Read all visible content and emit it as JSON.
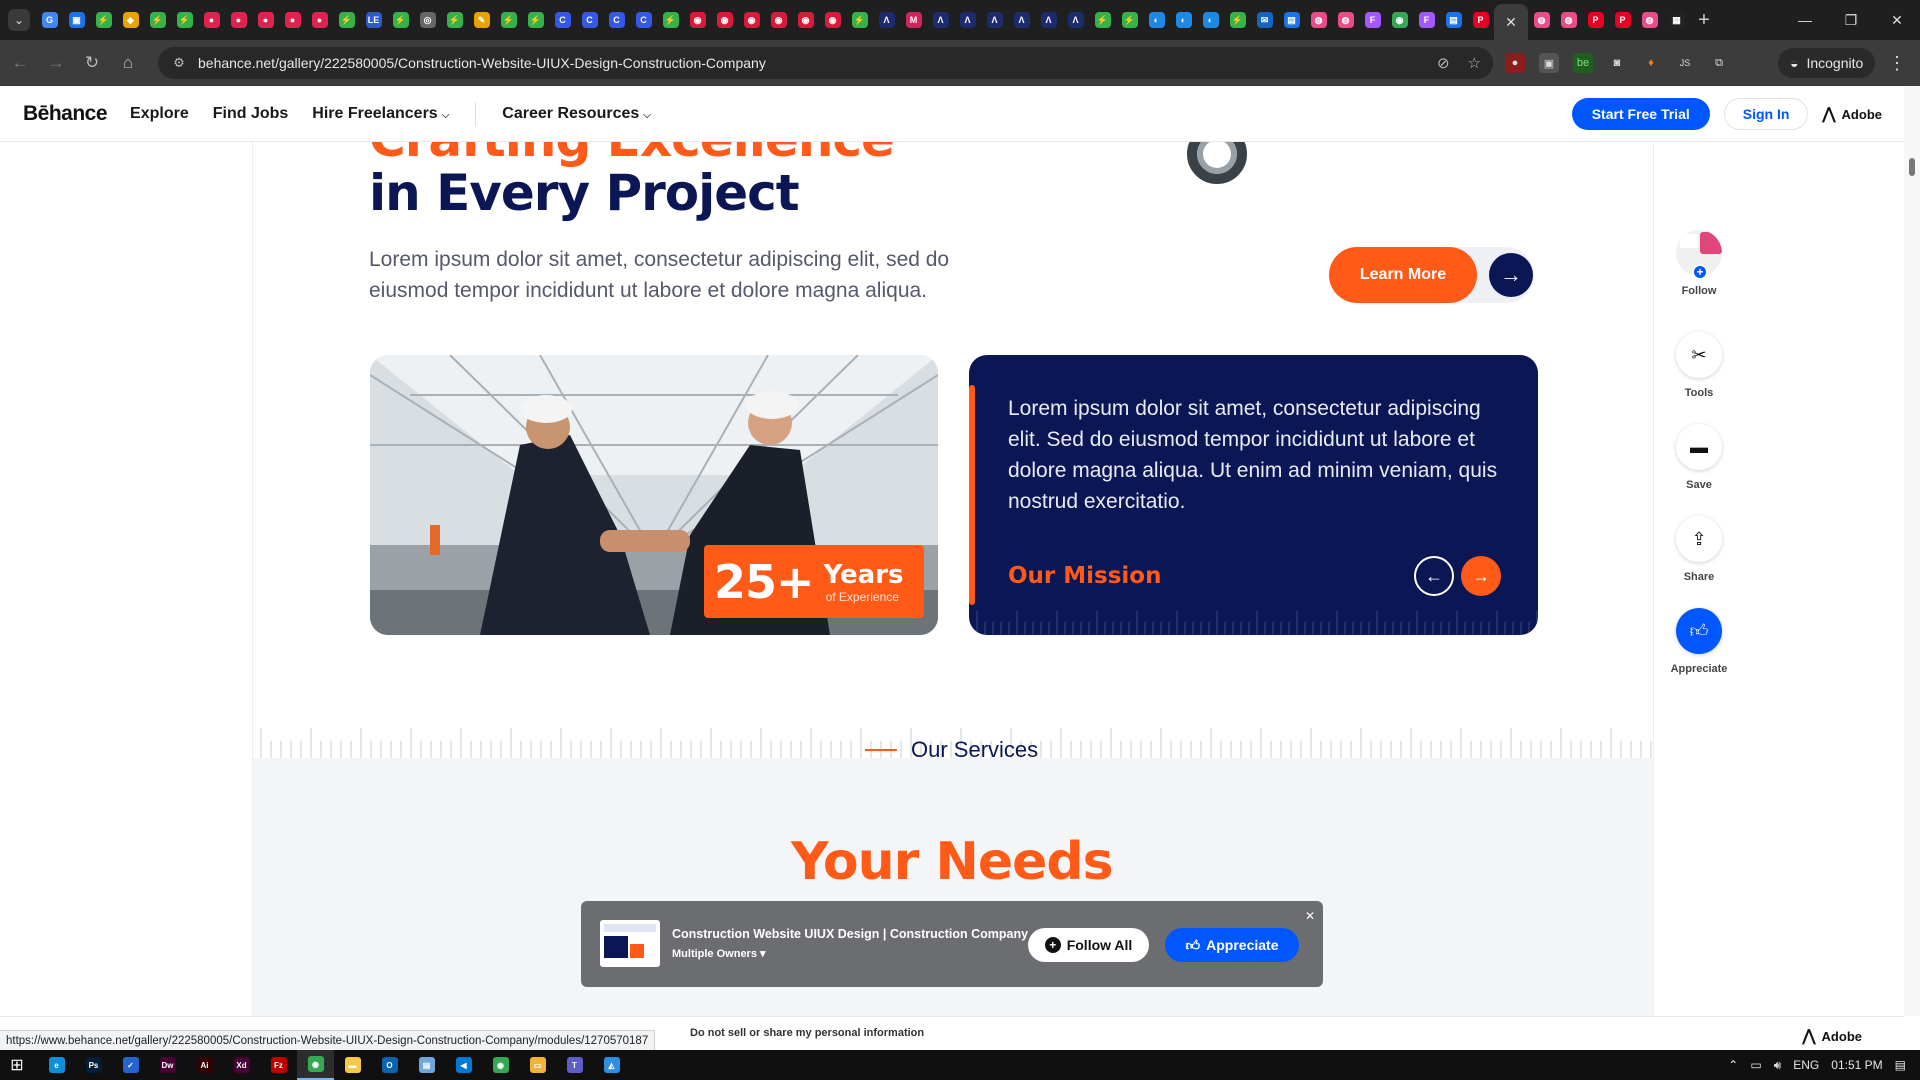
{
  "browser": {
    "tab_favicons": [
      {
        "name": "google-favicon",
        "color": "#4285f4",
        "glyph": "G"
      },
      {
        "name": "app-favicon",
        "color": "#1a73e8",
        "glyph": "▣"
      },
      {
        "name": "green-favicon",
        "color": "#36b24a",
        "glyph": "⚡"
      },
      {
        "name": "box-favicon",
        "color": "#e8a300",
        "glyph": "◆"
      },
      {
        "name": "green-favicon",
        "color": "#36b24a",
        "glyph": "⚡"
      },
      {
        "name": "green-favicon",
        "color": "#36b24a",
        "glyph": "⚡"
      },
      {
        "name": "red-favicon",
        "color": "#e0234e",
        "glyph": "●"
      },
      {
        "name": "red-favicon",
        "color": "#e0234e",
        "glyph": "●"
      },
      {
        "name": "red-favicon",
        "color": "#e0234e",
        "glyph": "●"
      },
      {
        "name": "red-favicon",
        "color": "#e0234e",
        "glyph": "●"
      },
      {
        "name": "red-favicon",
        "color": "#e0234e",
        "glyph": "●"
      },
      {
        "name": "green-favicon",
        "color": "#36b24a",
        "glyph": "⚡"
      },
      {
        "name": "le-favicon",
        "color": "#2c5cc5",
        "glyph": "LE"
      },
      {
        "name": "green-favicon",
        "color": "#36b24a",
        "glyph": "⚡"
      },
      {
        "name": "gray-favicon",
        "color": "#666666",
        "glyph": "◎"
      },
      {
        "name": "green-favicon",
        "color": "#36b24a",
        "glyph": "⚡"
      },
      {
        "name": "tool-favicon",
        "color": "#e8a300",
        "glyph": "✎"
      },
      {
        "name": "green-favicon",
        "color": "#36b24a",
        "glyph": "⚡"
      },
      {
        "name": "green-favicon",
        "color": "#36b24a",
        "glyph": "⚡"
      },
      {
        "name": "c-favicon",
        "color": "#3558e6",
        "glyph": "C"
      },
      {
        "name": "c-favicon",
        "color": "#3558e6",
        "glyph": "C"
      },
      {
        "name": "c-favicon",
        "color": "#3558e6",
        "glyph": "C"
      },
      {
        "name": "c-favicon",
        "color": "#3558e6",
        "glyph": "C"
      },
      {
        "name": "green-favicon",
        "color": "#36b24a",
        "glyph": "⚡"
      },
      {
        "name": "red-favicon",
        "color": "#d81b3a",
        "glyph": "◉"
      },
      {
        "name": "red-favicon",
        "color": "#d81b3a",
        "glyph": "◉"
      },
      {
        "name": "red-favicon",
        "color": "#d81b3a",
        "glyph": "◉"
      },
      {
        "name": "red-favicon",
        "color": "#d81b3a",
        "glyph": "◉"
      },
      {
        "name": "red-favicon",
        "color": "#d81b3a",
        "glyph": "◉"
      },
      {
        "name": "red-favicon",
        "color": "#d81b3a",
        "glyph": "◉"
      },
      {
        "name": "green-favicon",
        "color": "#36b24a",
        "glyph": "⚡"
      },
      {
        "name": "a-favicon",
        "color": "#1b2b6e",
        "glyph": "Λ"
      },
      {
        "name": "m-favicon",
        "color": "#d0245a",
        "glyph": "M"
      },
      {
        "name": "a-favicon",
        "color": "#1b2b6e",
        "glyph": "Λ"
      },
      {
        "name": "a-favicon",
        "color": "#1b2b6e",
        "glyph": "Λ"
      },
      {
        "name": "a-favicon",
        "color": "#1b2b6e",
        "glyph": "Λ"
      },
      {
        "name": "a-favicon",
        "color": "#1b2b6e",
        "glyph": "Λ"
      },
      {
        "name": "a-favicon",
        "color": "#1b2b6e",
        "glyph": "Λ"
      },
      {
        "name": "a-favicon",
        "color": "#1b2b6e",
        "glyph": "Λ"
      },
      {
        "name": "green-favicon",
        "color": "#36b24a",
        "glyph": "⚡"
      },
      {
        "name": "green-favicon",
        "color": "#36b24a",
        "glyph": "⚡"
      },
      {
        "name": "blue-favicon",
        "color": "#1e88e5",
        "glyph": "◐"
      },
      {
        "name": "blue-favicon",
        "color": "#1e88e5",
        "glyph": "◐"
      },
      {
        "name": "blue-favicon",
        "color": "#1e88e5",
        "glyph": "◐"
      },
      {
        "name": "green-favicon",
        "color": "#36b24a",
        "glyph": "⚡"
      },
      {
        "name": "blue-favicon",
        "color": "#1565c0",
        "glyph": "✉"
      },
      {
        "name": "blue-favicon",
        "color": "#1a73e8",
        "glyph": "▤"
      },
      {
        "name": "pink-favicon",
        "color": "#ea4c89",
        "glyph": "◍"
      },
      {
        "name": "pink-favicon",
        "color": "#ea4c89",
        "glyph": "◍"
      },
      {
        "name": "figma-favicon",
        "color": "#a259ff",
        "glyph": "F"
      },
      {
        "name": "chrome-favicon",
        "color": "#34a853",
        "glyph": "◉"
      },
      {
        "name": "figma-favicon",
        "color": "#a259ff",
        "glyph": "F"
      },
      {
        "name": "blue-favicon",
        "color": "#1a73e8",
        "glyph": "▤"
      },
      {
        "name": "pinterest-favicon",
        "color": "#e60023",
        "glyph": "P"
      }
    ],
    "active_tab_close": "✕",
    "tab_favicons_after": [
      {
        "name": "pink-favicon",
        "color": "#ea4c89",
        "glyph": "◍"
      },
      {
        "name": "pink-favicon",
        "color": "#ea4c89",
        "glyph": "◍"
      },
      {
        "name": "pinterest-favicon",
        "color": "#e60023",
        "glyph": "P"
      },
      {
        "name": "pinterest-favicon",
        "color": "#e60023",
        "glyph": "P"
      },
      {
        "name": "pink-favicon",
        "color": "#ea4c89",
        "glyph": "◍"
      },
      {
        "name": "notion-favicon",
        "color": "#222222",
        "glyph": "▦"
      }
    ],
    "url": "behance.net/gallery/222580005/Construction-Website-UIUX-Design-Construction-Company",
    "incognito_label": "Incognito"
  },
  "header": {
    "logo": "Bēhance",
    "nav": [
      "Explore",
      "Find Jobs",
      "Hire Freelancers",
      "Career Resources"
    ],
    "start_trial": "Start Free Trial",
    "sign_in": "Sign In",
    "adobe": "Adobe"
  },
  "project": {
    "headline_top": "Crafting Excellence",
    "headline": "in Every Project",
    "intro": "Lorem ipsum dolor sit amet, consectetur adipiscing elit, sed do eiusmod tempor incididunt ut labore et dolore magna aliqua.",
    "learn_more": "Learn More",
    "experience_number": "25+",
    "experience_years": "Years",
    "experience_sub": "of Experience",
    "mission_text": "Lorem ipsum dolor sit amet, consectetur adipiscing elit. Sed do eiusmod tempor incididunt ut labore et dolore magna aliqua. Ut enim ad minim veniam, quis nostrud exercitatio.",
    "mission_title": "Our Mission",
    "services_label": "Our Services",
    "needs_heading": "Your Needs",
    "colors": {
      "orange": "#ff5a17",
      "navy": "#0b1655"
    }
  },
  "rail": {
    "follow": "Follow",
    "tools": "Tools",
    "save": "Save",
    "share": "Share",
    "appreciate": "Appreciate"
  },
  "floating_bar": {
    "title": "Construction Website UIUX Design | Construction Company",
    "owners": "Multiple Owners",
    "follow_all": "Follow All",
    "appreciate": "Appreciate"
  },
  "footer": {
    "privacy": "Do not sell or share my personal information",
    "adobe": "Adobe",
    "status_url": "https://www.behance.net/gallery/222580005/Construction-Website-UIUX-Design-Construction-Company/modules/1270570187"
  },
  "taskbar": {
    "apps": [
      {
        "name": "edge-app",
        "color": "#0f8fd6",
        "glyph": "e"
      },
      {
        "name": "photoshop-app",
        "color": "#001e36",
        "glyph": "Ps"
      },
      {
        "name": "todo-app",
        "color": "#2564cf",
        "glyph": "✓"
      },
      {
        "name": "dreamweaver-app",
        "color": "#470137",
        "glyph": "Dw"
      },
      {
        "name": "illustrator-app",
        "color": "#330000",
        "glyph": "Ai"
      },
      {
        "name": "xd-app",
        "color": "#470137",
        "glyph": "Xd"
      },
      {
        "name": "filezilla-app",
        "color": "#bf0000",
        "glyph": "Fz"
      },
      {
        "name": "chrome-app",
        "color": "#34a853",
        "glyph": "◉"
      },
      {
        "name": "sticky-notes-app",
        "color": "#f7c948",
        "glyph": "▬"
      },
      {
        "name": "outlook-app",
        "color": "#0a64ad",
        "glyph": "O"
      },
      {
        "name": "notepad-app",
        "color": "#6ea7d8",
        "glyph": "▤"
      },
      {
        "name": "vscode-app",
        "color": "#0078d4",
        "glyph": "◀"
      },
      {
        "name": "chrome-app",
        "color": "#34a853",
        "glyph": "◉"
      },
      {
        "name": "explorer-app",
        "color": "#f3b23c",
        "glyph": "▭"
      },
      {
        "name": "teams-app",
        "color": "#5b5fc7",
        "glyph": "T"
      },
      {
        "name": "photos-app",
        "color": "#2d8fe0",
        "glyph": "◭"
      }
    ],
    "active_app_index": 7,
    "language": "ENG",
    "time": "01:51 PM"
  }
}
